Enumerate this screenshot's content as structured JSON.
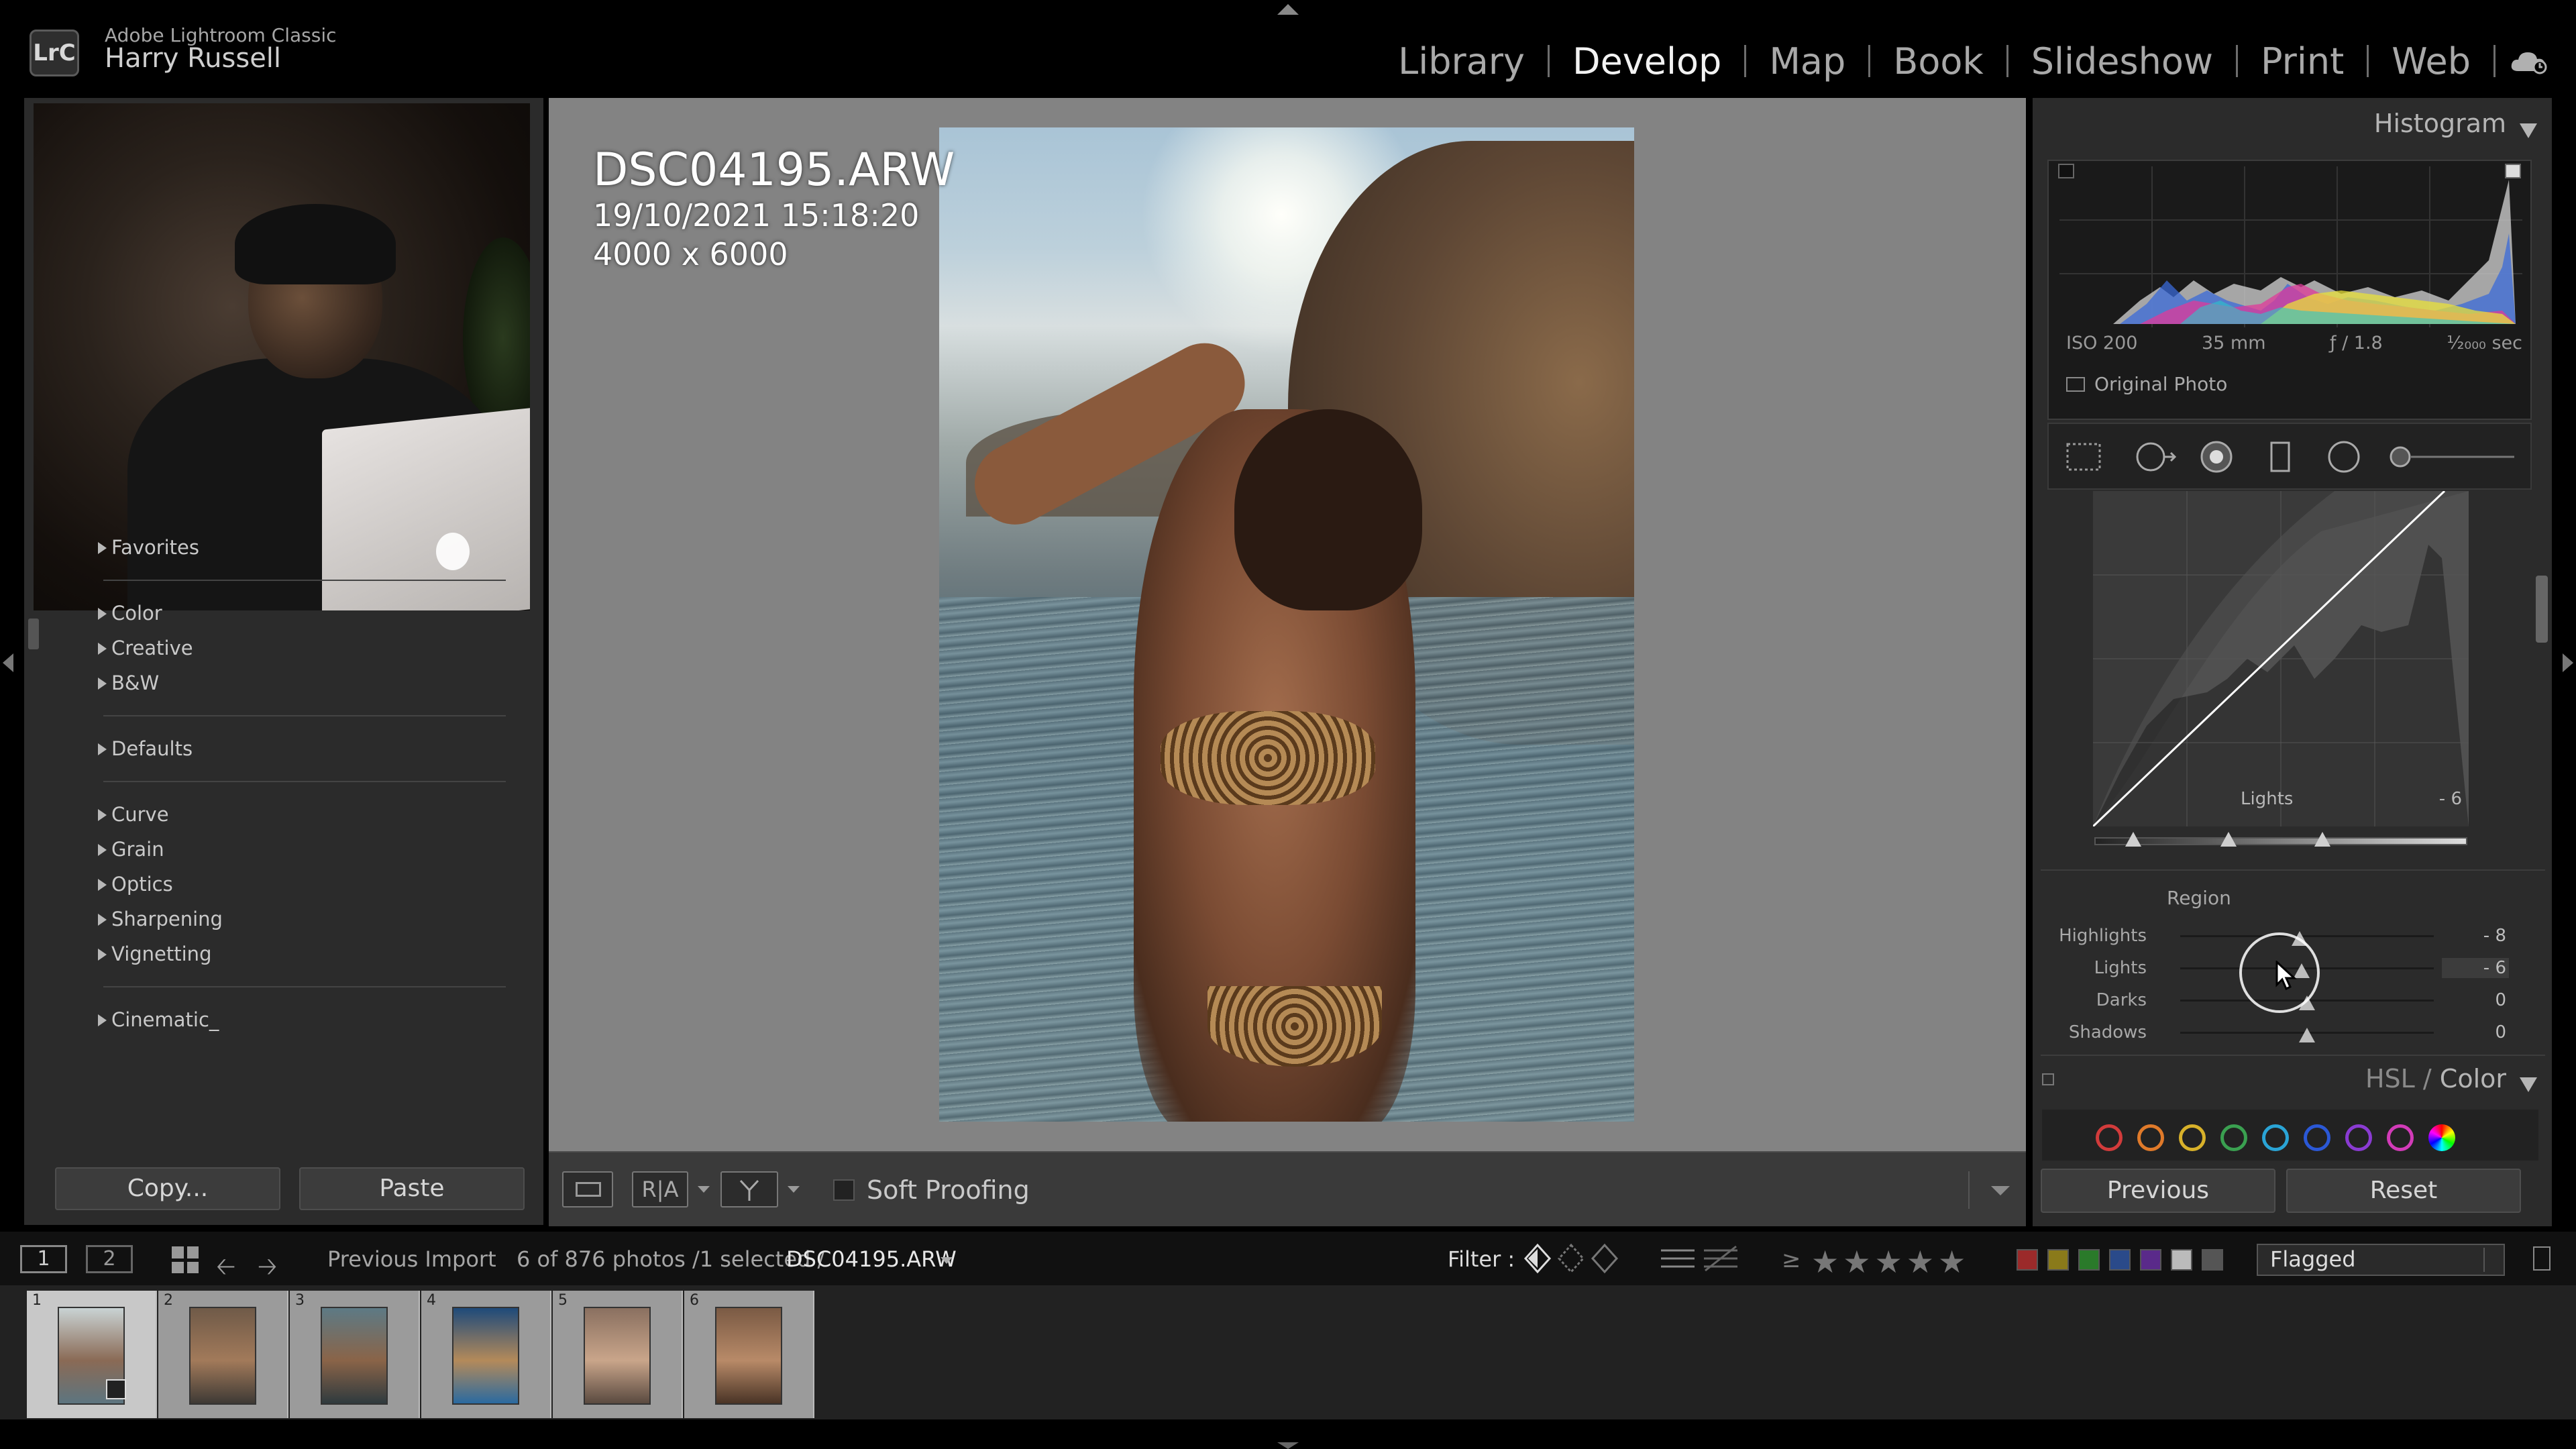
{
  "app": {
    "product": "Adobe Lightroom Classic",
    "logo_text": "LrC",
    "user": "Harry Russell"
  },
  "modules": [
    {
      "label": "Library",
      "active": false
    },
    {
      "label": "Develop",
      "active": true
    },
    {
      "label": "Map",
      "active": false
    },
    {
      "label": "Book",
      "active": false
    },
    {
      "label": "Slideshow",
      "active": false
    },
    {
      "label": "Print",
      "active": false
    },
    {
      "label": "Web",
      "active": false
    }
  ],
  "presets": {
    "groups": [
      [
        "Favorites"
      ],
      [
        "Color",
        "Creative",
        "B&W"
      ],
      [
        "Defaults"
      ],
      [
        "Curve",
        "Grain",
        "Optics",
        "Sharpening",
        "Vignetting"
      ],
      [
        "Cinematic_"
      ]
    ]
  },
  "left_buttons": {
    "copy": "Copy...",
    "paste": "Paste"
  },
  "photo_info": {
    "filename": "DSC04195.ARW",
    "datetime": "19/10/2021 15:18:20",
    "dimensions": "4000 x 6000"
  },
  "toolbar": {
    "soft_proofing": "Soft Proofing",
    "before_after": "R|A"
  },
  "histogram": {
    "title": "Histogram",
    "iso": "ISO 200",
    "focal": "35 mm",
    "aperture": "ƒ / 1.8",
    "shutter": "¹⁄₂₀₀₀ sec",
    "original_photo": "Original Photo"
  },
  "tone_curve": {
    "region_label": "Lights",
    "region_value": "- 6"
  },
  "region": {
    "title": "Region",
    "sliders": [
      {
        "label": "Highlights",
        "value": "- 8",
        "position": 0.47
      },
      {
        "label": "Lights",
        "value": "- 6",
        "position": 0.48
      },
      {
        "label": "Darks",
        "value": "0",
        "position": 0.5
      },
      {
        "label": "Shadows",
        "value": "0",
        "position": 0.5
      }
    ]
  },
  "hsl": {
    "title_a": "HSL",
    "sep": " / ",
    "title_b": "Color"
  },
  "color_swatches": [
    "#d23b3b",
    "#e07a2a",
    "#d8b12a",
    "#3aa050",
    "#2aa4d6",
    "#2b58d6",
    "#8a3bd2",
    "#d23bb8",
    "rainbow"
  ],
  "right_buttons": {
    "previous": "Previous",
    "reset": "Reset"
  },
  "filmstrip_bar": {
    "view1": "1",
    "view2": "2",
    "source": "Previous Import",
    "count_text": "6 of 876 photos /1 selected /",
    "selected_file": "DSC04195.ARW",
    "filter_label": "Filter :",
    "rating_ge": "≥",
    "stars": "★★★★★",
    "color_labels": [
      "#9b2a2a",
      "#8a7a1a",
      "#2a7a2a",
      "#2a4a8a",
      "#5a2a8a",
      "#bbbbbb",
      "#555555"
    ],
    "flag_filter": "Flagged"
  },
  "thumbnails": [
    {
      "num": "1",
      "selected": true,
      "colors": [
        "#c9d3d4",
        "#8a6a55",
        "#5d7580"
      ]
    },
    {
      "num": "2",
      "selected": false,
      "colors": [
        "#6f5a48",
        "#a27a5a",
        "#3e3a35"
      ]
    },
    {
      "num": "3",
      "selected": false,
      "colors": [
        "#5d7a85",
        "#8a6448",
        "#2f3a3e"
      ]
    },
    {
      "num": "4",
      "selected": false,
      "colors": [
        "#1e4a7a",
        "#b48a5a",
        "#2a6aa0"
      ]
    },
    {
      "num": "5",
      "selected": false,
      "colors": [
        "#8a7060",
        "#c9a58a",
        "#5a4a40"
      ]
    },
    {
      "num": "6",
      "selected": false,
      "colors": [
        "#7a5a44",
        "#b88a68",
        "#4a3426"
      ]
    }
  ]
}
